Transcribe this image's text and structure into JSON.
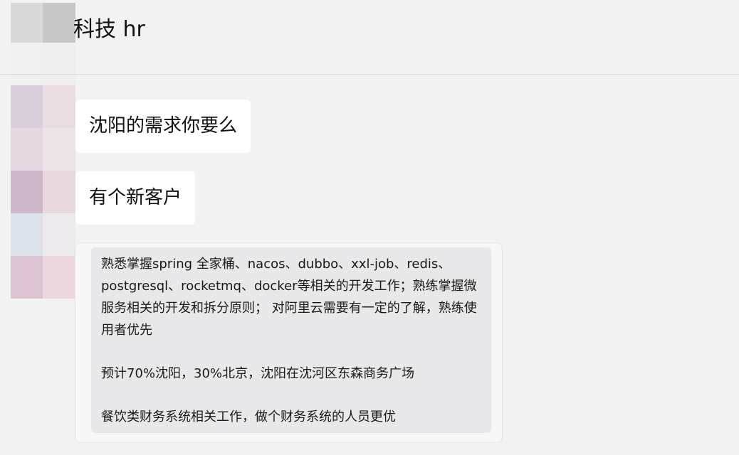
{
  "header": {
    "title": "科技 hr"
  },
  "messages": [
    {
      "text": "沈阳的需求你要么"
    },
    {
      "text": "有个新客户"
    }
  ],
  "quote": {
    "paragraph1": "熟悉掌握spring 全家桶、nacos、dubbo、xxl-job、redis、postgresql、rocketmq、docker等相关的开发工作；熟练掌握微服务相关的开发和拆分原则； 对阿里云需要有一定的了解，熟练使用者优先",
    "paragraph2": "预计70%沈阳，30%北京，沈阳在沈河区东森商务广场",
    "paragraph3": "餐饮类财务系统相关工作，做个财务系统的人员更优"
  },
  "colors": {
    "background": "#f2f2f2",
    "bubble": "#ffffff",
    "quote_background": "#e8e8ea"
  }
}
